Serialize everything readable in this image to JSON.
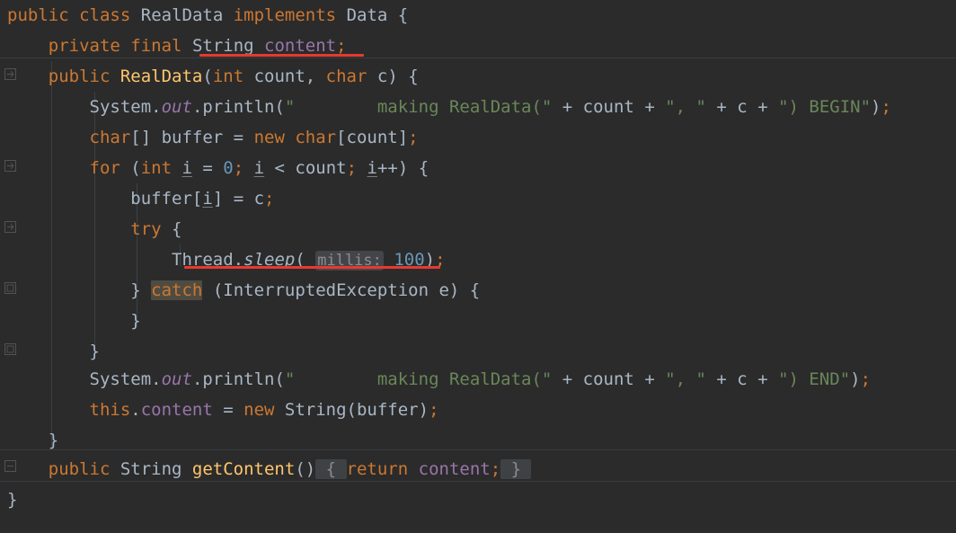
{
  "editor": {
    "theme": "darcula",
    "background": "#2b2b2b",
    "default_text_color": "#a9b7c6",
    "language": "java",
    "colors": {
      "keyword": "#cc7832",
      "string": "#6a8759",
      "number": "#6897bb",
      "field": "#9876aa",
      "declaration": "#ffc66d",
      "error_underline": "#e8392e",
      "folded_region_bg": "#3f4244",
      "caret_highlight_bg": "#4f4b41",
      "param_hint_bg": "#43454a",
      "indent_guide": "#3c3f41"
    }
  },
  "code": {
    "lines": [
      {
        "n": 1,
        "text": "public class RealData implements Data {",
        "tokens": [
          {
            "t": "public",
            "c": "kw"
          },
          {
            "t": " ",
            "c": "punc"
          },
          {
            "t": "class",
            "c": "kw"
          },
          {
            "t": " ",
            "c": "punc"
          },
          {
            "t": "RealData",
            "c": "cls"
          },
          {
            "t": " ",
            "c": "punc"
          },
          {
            "t": "implements",
            "c": "kw"
          },
          {
            "t": " ",
            "c": "punc"
          },
          {
            "t": "Data",
            "c": "cls"
          },
          {
            "t": " {",
            "c": "punc"
          }
        ]
      },
      {
        "n": 2,
        "text": "    private final String content;",
        "tokens": [
          {
            "t": "    ",
            "c": "punc"
          },
          {
            "t": "private",
            "c": "kw"
          },
          {
            "t": " ",
            "c": "punc"
          },
          {
            "t": "final",
            "c": "kw"
          },
          {
            "t": " ",
            "c": "punc"
          },
          {
            "t": "String",
            "c": "cls"
          },
          {
            "t": " ",
            "c": "punc"
          },
          {
            "t": "content",
            "c": "field"
          },
          {
            "t": ";",
            "c": "semi"
          }
        ]
      },
      {
        "n": 3,
        "text": "    public RealData(int count, char c) {",
        "tokens": [
          {
            "t": "    ",
            "c": "punc"
          },
          {
            "t": "public",
            "c": "kw"
          },
          {
            "t": " ",
            "c": "punc"
          },
          {
            "t": "RealData",
            "c": "ctor"
          },
          {
            "t": "(",
            "c": "punc"
          },
          {
            "t": "int",
            "c": "kw"
          },
          {
            "t": " count, ",
            "c": "punc"
          },
          {
            "t": "char",
            "c": "kw"
          },
          {
            "t": " c) {",
            "c": "punc"
          }
        ]
      },
      {
        "n": 4,
        "text": "        System.out.println(\"        making RealData(\" + count + \", \" + c + \") BEGIN\");",
        "tokens": []
      },
      {
        "n": 5,
        "text": "        char[] buffer = new char[count];",
        "tokens": []
      },
      {
        "n": 6,
        "text": "        for (int i = 0; i < count; i++) {",
        "tokens": []
      },
      {
        "n": 7,
        "text": "            buffer[i] = c;",
        "tokens": []
      },
      {
        "n": 8,
        "text": "            try {",
        "tokens": []
      },
      {
        "n": 9,
        "text": "                Thread.sleep( millis: 100);",
        "tokens": []
      },
      {
        "n": 10,
        "text": "            } catch (InterruptedException e) {",
        "tokens": []
      },
      {
        "n": 11,
        "text": "            }",
        "tokens": []
      },
      {
        "n": 12,
        "text": "        }",
        "tokens": []
      },
      {
        "n": 13,
        "text": "        System.out.println(\"        making RealData(\" + count + \", \" + c + \") END\");",
        "tokens": []
      },
      {
        "n": 14,
        "text": "        this.content = new String(buffer);",
        "tokens": []
      },
      {
        "n": 15,
        "text": "    }",
        "tokens": []
      },
      {
        "n": 16,
        "text": "    public String getContent() { return content; }",
        "tokens": []
      },
      {
        "n": 17,
        "text": "}",
        "tokens": []
      }
    ]
  },
  "inlay_hints": [
    {
      "label": "millis:",
      "line": 9,
      "for_argument": "100"
    }
  ],
  "highlights": {
    "caret_identifier": "catch",
    "folded_braces": [
      "{",
      "}"
    ],
    "error_underlines": [
      {
        "line": 2,
        "covers": "String content;"
      },
      {
        "line": 9,
        "covers": "Thread.sleep( millis: 100);"
      }
    ]
  },
  "gutter": {
    "fold_markers": [
      {
        "type": "fold-expanded-icon",
        "line": 3
      },
      {
        "type": "fold-expanded-icon",
        "line": 6
      },
      {
        "type": "fold-expanded-icon",
        "line": 8
      },
      {
        "type": "fold-expanded-icon",
        "line": 10
      },
      {
        "type": "fold-expanded-icon",
        "line": 12
      },
      {
        "type": "fold-collapsed-icon",
        "line": 16
      }
    ]
  },
  "line_text": {
    "l1_public": "public",
    "l1_class": "class",
    "l1_realdata": "RealData",
    "l1_implements": "implements",
    "l1_data": "Data",
    "l1_brace": " {",
    "l2_indent": "    ",
    "l2_private": "private",
    "l2_final": "final",
    "l2_string": "String",
    "l2_content": "content",
    "l2_semi": ";",
    "l3_indent": "    ",
    "l3_public": "public",
    "l3_realdata": "RealData",
    "l3_lparen": "(",
    "l3_int": "int",
    "l3_count": " count, ",
    "l3_char": "char",
    "l3_tail": " c) {",
    "l4_indent": "        ",
    "l4_system": "System",
    "l4_dot1": ".",
    "l4_out": "out",
    "l4_dot2": ".",
    "l4_println": "println",
    "l4_lparen": "(",
    "l4_str1": "\"        making RealData(\"",
    "l4_plus1": " + ",
    "l4_count": "count",
    "l4_plus2": " + ",
    "l4_str2": "\", \"",
    "l4_plus3": " + ",
    "l4_c": "c",
    "l4_plus4": " + ",
    "l4_str3": "\") BEGIN\"",
    "l4_rparen": ")",
    "l4_semi": ";",
    "l5_indent": "        ",
    "l5_char": "char",
    "l5_mid": "[] buffer = ",
    "l5_new": "new",
    "l5_char2": " char",
    "l5_tail": "[count]",
    "l5_semi": ";",
    "l6_indent": "        ",
    "l6_for": "for",
    "l6_lparen": " (",
    "l6_int": "int",
    "l6_sp1": " ",
    "l6_i1": "i",
    "l6_eq": " = ",
    "l6_zero": "0",
    "l6_semi1": ";",
    "l6_sp2": " ",
    "l6_i2": "i",
    "l6_lt": " < count",
    "l6_semi2": ";",
    "l6_sp3": " ",
    "l6_i3": "i",
    "l6_tail": "++) {",
    "l7_indent": "            ",
    "l7_buffer": "buffer[",
    "l7_i": "i",
    "l7_tail": "] = c",
    "l7_semi": ";",
    "l8_indent": "            ",
    "l8_try": "try",
    "l8_brace": " {",
    "l9_indent": "                ",
    "l9_thread": "Thread",
    "l9_dot": ".",
    "l9_sleep": "sleep",
    "l9_lparen": "(",
    "l9_hint": "millis:",
    "l9_num": "100",
    "l9_rparen": ")",
    "l9_semi": ";",
    "l10_indent": "            ",
    "l10_rbrace": "} ",
    "l10_catch": "catch",
    "l10_tail": " (InterruptedException e) {",
    "l11_indent": "            ",
    "l11_rbrace": "}",
    "l12_indent": "        ",
    "l12_rbrace": "}",
    "l13_indent": "        ",
    "l13_system": "System",
    "l13_dot1": ".",
    "l13_out": "out",
    "l13_dot2": ".",
    "l13_println": "println",
    "l13_lparen": "(",
    "l13_str1": "\"        making RealData(\"",
    "l13_plus1": " + ",
    "l13_count": "count",
    "l13_plus2": " + ",
    "l13_str2": "\", \"",
    "l13_plus3": " + ",
    "l13_c": "c",
    "l13_plus4": " + ",
    "l13_str3": "\") END\"",
    "l13_rparen": ")",
    "l13_semi": ";",
    "l14_indent": "        ",
    "l14_this": "this",
    "l14_dot": ".",
    "l14_content": "content",
    "l14_eq": " = ",
    "l14_new": "new",
    "l14_string": " String(buffer)",
    "l14_semi": ";",
    "l15_indent": "    ",
    "l15_rbrace": "}",
    "l16_indent": "    ",
    "l16_public": "public",
    "l16_string": " String ",
    "l16_getcontent": "getContent",
    "l16_parens": "()",
    "l16_fold_open": " { ",
    "l16_return": "return",
    "l16_sp": " ",
    "l16_content": "content",
    "l16_semi": ";",
    "l16_fold_close": " } ",
    "l17_rbrace": "}"
  }
}
